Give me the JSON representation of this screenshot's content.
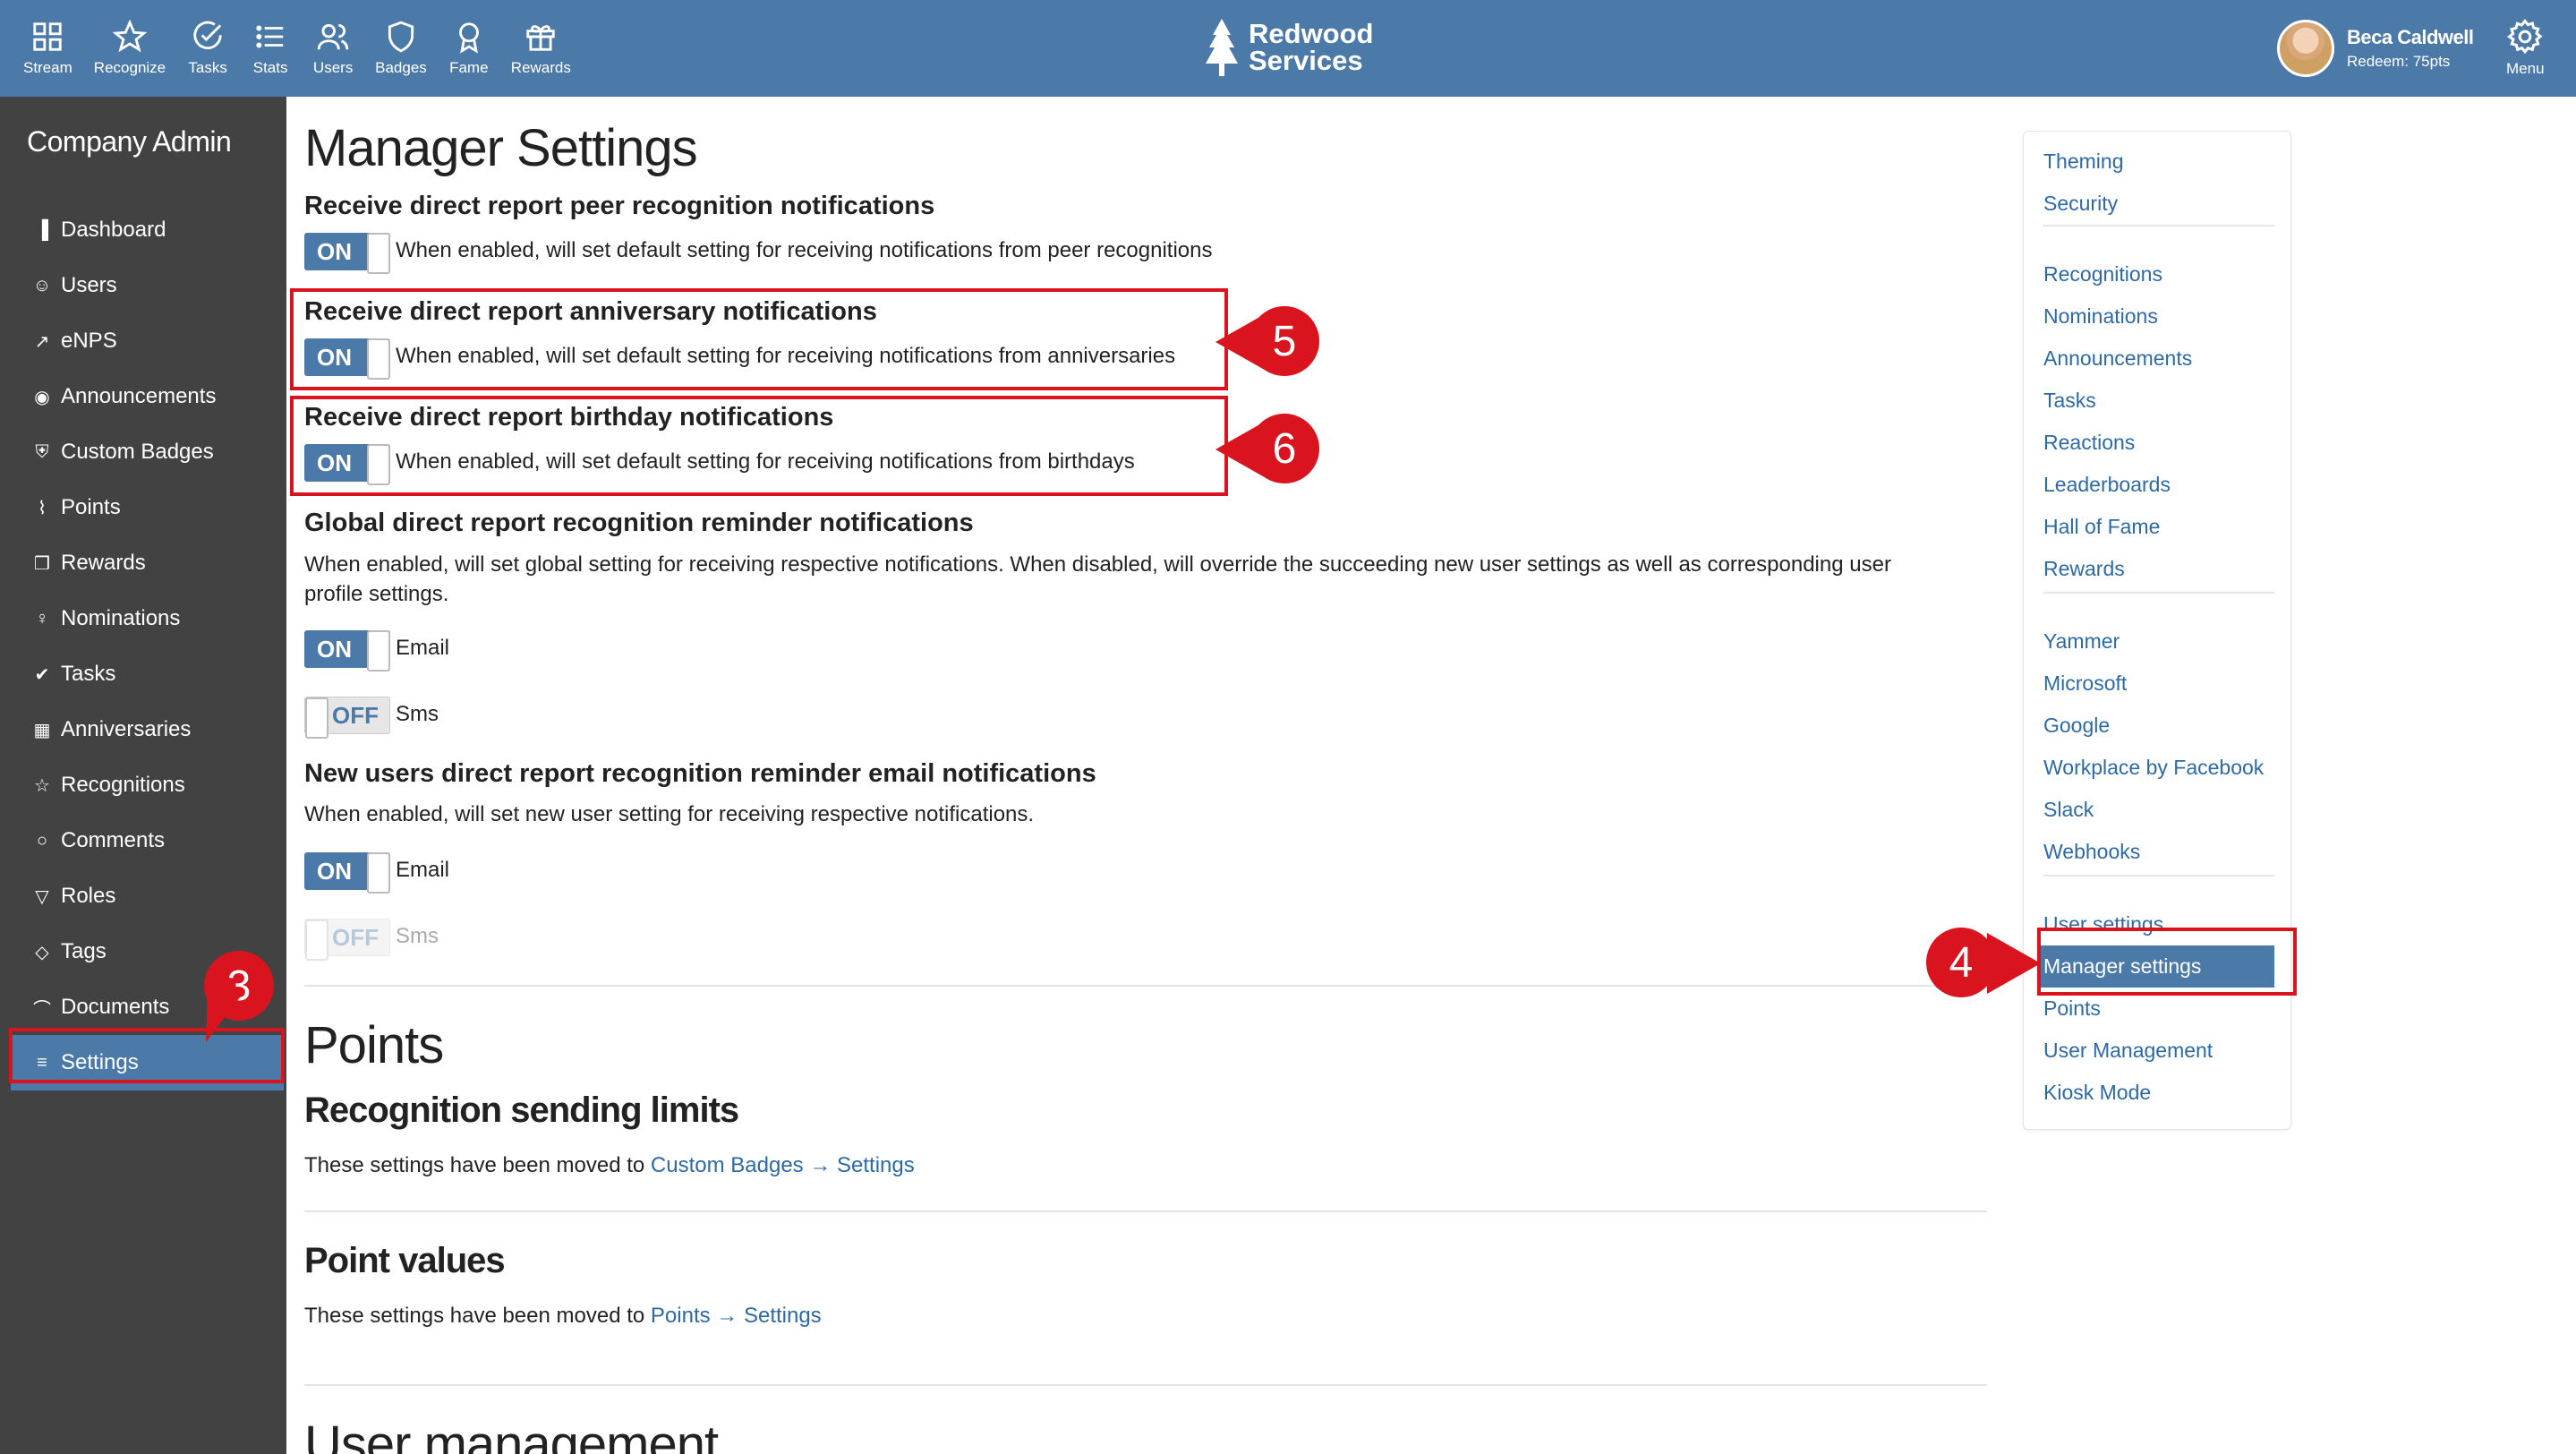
{
  "topnav": {
    "items": [
      {
        "label": "Stream",
        "icon": "grid-icon"
      },
      {
        "label": "Recognize",
        "icon": "star-icon"
      },
      {
        "label": "Tasks",
        "icon": "check-circle-icon"
      },
      {
        "label": "Stats",
        "icon": "list-icon"
      },
      {
        "label": "Users",
        "icon": "users-icon"
      },
      {
        "label": "Badges",
        "icon": "shield-icon"
      },
      {
        "label": "Fame",
        "icon": "award-icon"
      },
      {
        "label": "Rewards",
        "icon": "gift-icon"
      }
    ],
    "brand_line1": "Redwood",
    "brand_line2": "Services",
    "user_name": "Beca Caldwell",
    "user_sub": "Redeem: 75pts",
    "menu_label": "Menu"
  },
  "sidebar": {
    "title": "Company Admin",
    "items": [
      {
        "label": "Dashboard",
        "icon": "bar-chart-icon",
        "glyph": "▐"
      },
      {
        "label": "Users",
        "icon": "user-icon",
        "glyph": "☺"
      },
      {
        "label": "eNPS",
        "icon": "trending-up-icon",
        "glyph": "↗"
      },
      {
        "label": "Announcements",
        "icon": "broadcast-icon",
        "glyph": "◉"
      },
      {
        "label": "Custom Badges",
        "icon": "shield-icon",
        "glyph": "⛨"
      },
      {
        "label": "Points",
        "icon": "activity-icon",
        "glyph": "⌇"
      },
      {
        "label": "Rewards",
        "icon": "gift-icon",
        "glyph": "❒"
      },
      {
        "label": "Nominations",
        "icon": "award-icon",
        "glyph": "♀"
      },
      {
        "label": "Tasks",
        "icon": "check-circle-icon",
        "glyph": "✔"
      },
      {
        "label": "Anniversaries",
        "icon": "calendar-icon",
        "glyph": "▦"
      },
      {
        "label": "Recognitions",
        "icon": "star-icon",
        "glyph": "☆"
      },
      {
        "label": "Comments",
        "icon": "comment-icon",
        "glyph": "○"
      },
      {
        "label": "Roles",
        "icon": "filter-icon",
        "glyph": "▽"
      },
      {
        "label": "Tags",
        "icon": "tag-icon",
        "glyph": "◇"
      },
      {
        "label": "Documents",
        "icon": "paperclip-icon",
        "glyph": "⌒"
      },
      {
        "label": "Settings",
        "icon": "sliders-icon",
        "glyph": "≡"
      }
    ],
    "active_index": 15
  },
  "main": {
    "title": "Manager Settings",
    "sections": [
      {
        "title": "Receive direct report peer recognition notifications",
        "toggle": "ON",
        "desc": "When enabled, will set default setting for receiving notifications from peer recognitions"
      },
      {
        "title": "Receive direct report anniversary notifications",
        "toggle": "ON",
        "desc": "When enabled, will set default setting for receiving notifications from anniversaries"
      },
      {
        "title": "Receive direct report birthday notifications",
        "toggle": "ON",
        "desc": "When enabled, will set default setting for receiving notifications from birthdays"
      }
    ],
    "global": {
      "title": "Global direct report recognition reminder notifications",
      "desc": "When enabled, will set global setting for receiving respective notifications. When disabled, will override the succeeding new user settings as well as corresponding user profile settings.",
      "email_toggle": "ON",
      "email_label": "Email",
      "sms_toggle": "OFF",
      "sms_label": "Sms"
    },
    "new_users": {
      "title": "New users direct report recognition reminder email notifications",
      "desc": "When enabled, will set new user setting for receiving respective notifications.",
      "email_toggle": "ON",
      "email_label": "Email",
      "sms_toggle": "OFF",
      "sms_label": "Sms"
    },
    "points": {
      "title": "Points",
      "sending_title": "Recognition sending limits",
      "sending_prefix": "These settings have been moved to",
      "sending_link": "Custom Badges → Settings",
      "values_title": "Point values",
      "values_prefix": "These settings have been moved to",
      "values_link": "Points → Settings"
    },
    "user_management_title": "User management"
  },
  "subnav": {
    "group1": [
      "Theming",
      "Security"
    ],
    "group2": [
      "Recognitions",
      "Nominations",
      "Announcements",
      "Tasks",
      "Reactions",
      "Leaderboards",
      "Hall of Fame",
      "Rewards"
    ],
    "group3": [
      "Yammer",
      "Microsoft",
      "Google",
      "Workplace by Facebook",
      "Slack",
      "Webhooks"
    ],
    "group4": [
      "User settings",
      "Manager settings",
      "Points",
      "User Management",
      "Kiosk Mode"
    ]
  },
  "annotations": {
    "step3": "3",
    "step4": "4",
    "step5": "5",
    "step6": "6",
    "color": "#d9141e"
  }
}
